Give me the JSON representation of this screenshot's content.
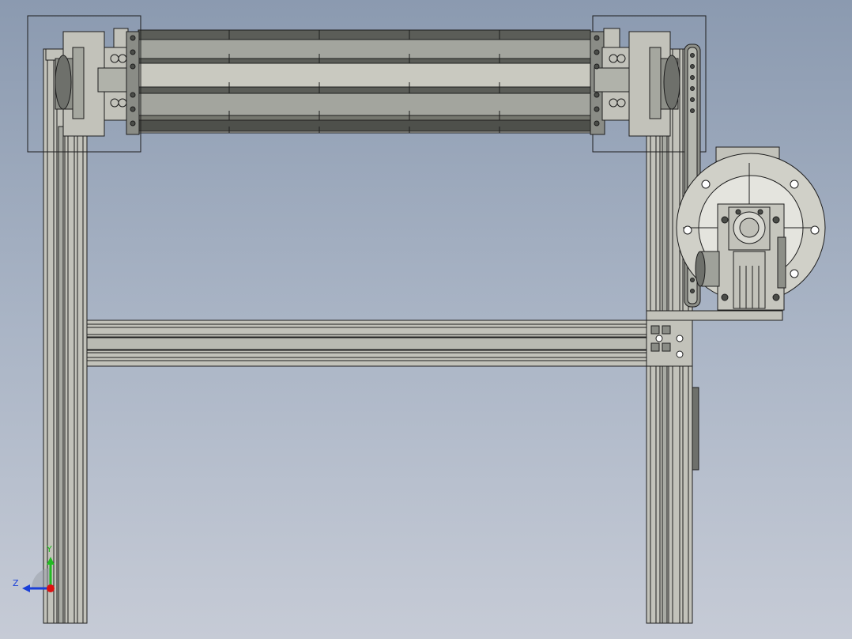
{
  "viewport": {
    "background_top": "#8b9ab0",
    "background_bottom": "#c6cbd6"
  },
  "model": {
    "part_fill": "#c2c2ba",
    "part_dark": "#6e706b",
    "edge_color": "#1e1e1e",
    "roller_light": "#c9c9c0",
    "roller_dark": "#5b5d58"
  },
  "triad": {
    "y_label": "Y",
    "z_label": "Z",
    "y_color": "#22bb22",
    "z_color": "#1a3fd8",
    "x_color": "#dd1111"
  }
}
